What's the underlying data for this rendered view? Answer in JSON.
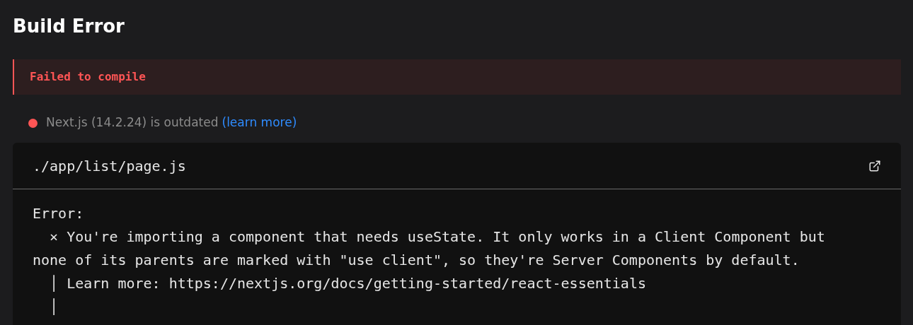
{
  "title": "Build Error",
  "banner": {
    "text": "Failed to compile"
  },
  "version_notice": {
    "color": "#ff5555",
    "text": "Next.js (14.2.24) is outdated",
    "link": "(learn more)"
  },
  "code_frame": {
    "file": "./app/list/page.js",
    "lines": [
      "Error:",
      "  × You're importing a component that needs useState. It only works in a Client Component but none of its parents are marked with \"use client\", so they're Server Components by default.",
      "  │ Learn more: https://nextjs.org/docs/getting-started/react-essentials",
      "  │"
    ]
  }
}
